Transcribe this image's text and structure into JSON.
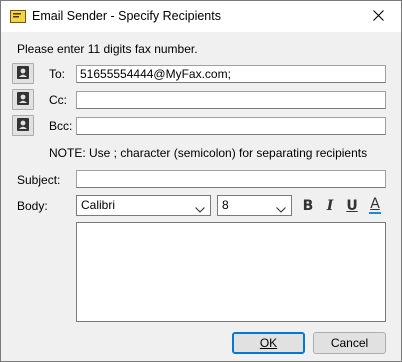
{
  "window": {
    "title": "Email Sender - Specify Recipients",
    "icon": "envelope-icon",
    "close_icon": "close-icon"
  },
  "instructions": "Please enter 11 digits fax number.",
  "recipients": {
    "to_label": "To:",
    "to_value": "51655554444@MyFax.com;",
    "cc_label": "Cc:",
    "cc_value": "",
    "bcc_label": "Bcc:",
    "bcc_value": "",
    "address_book_icon": "contact-card-icon"
  },
  "note": "NOTE: Use ; character (semicolon) for separating recipients",
  "subject": {
    "label": "Subject:",
    "value": ""
  },
  "body": {
    "label": "Body:",
    "font_name": "Calibri",
    "font_size": "8",
    "bold": "B",
    "italic": "I",
    "underline": "U",
    "font_color": "A",
    "font_color_value": "#1e88e5",
    "text": ""
  },
  "buttons": {
    "ok": "OK",
    "cancel": "Cancel"
  }
}
